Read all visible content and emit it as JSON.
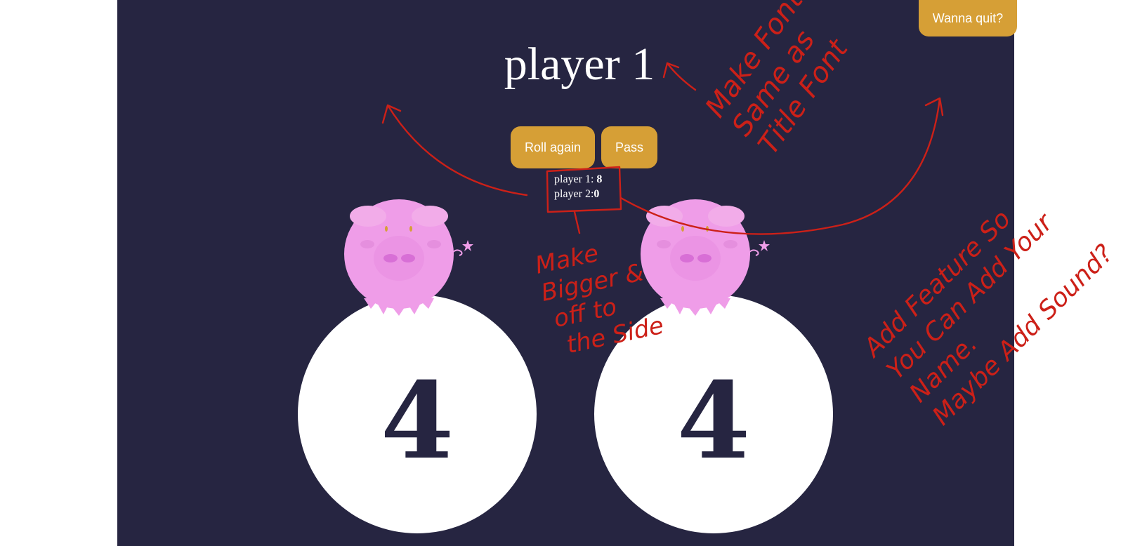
{
  "header": {
    "quit_label": "Wanna quit?"
  },
  "game": {
    "current_player": "player 1"
  },
  "controls": {
    "roll_label": "Roll again",
    "pass_label": "Pass"
  },
  "scoreboard": {
    "p1_label": "player 1: ",
    "p1_score": "8",
    "p2_label": "player 2:",
    "p2_score": "0"
  },
  "dice": [
    {
      "value": "4"
    },
    {
      "value": "4"
    }
  ],
  "annotations": {
    "font_note": [
      "Make Font",
      "Same as",
      "Title Font"
    ],
    "score_note": [
      "Make",
      "Bigger &",
      "off to",
      "the Side"
    ],
    "feature_note": [
      "Add Feature So",
      "You Can Add Your",
      "Name.",
      "Maybe Add Sound?"
    ]
  },
  "colors": {
    "background": "#262541",
    "button": "#d69f36",
    "die_face": "#ffffff",
    "pig": "#ef9de8",
    "annotation": "#cc2018"
  },
  "icons": {
    "mascot": "pig-icon"
  }
}
